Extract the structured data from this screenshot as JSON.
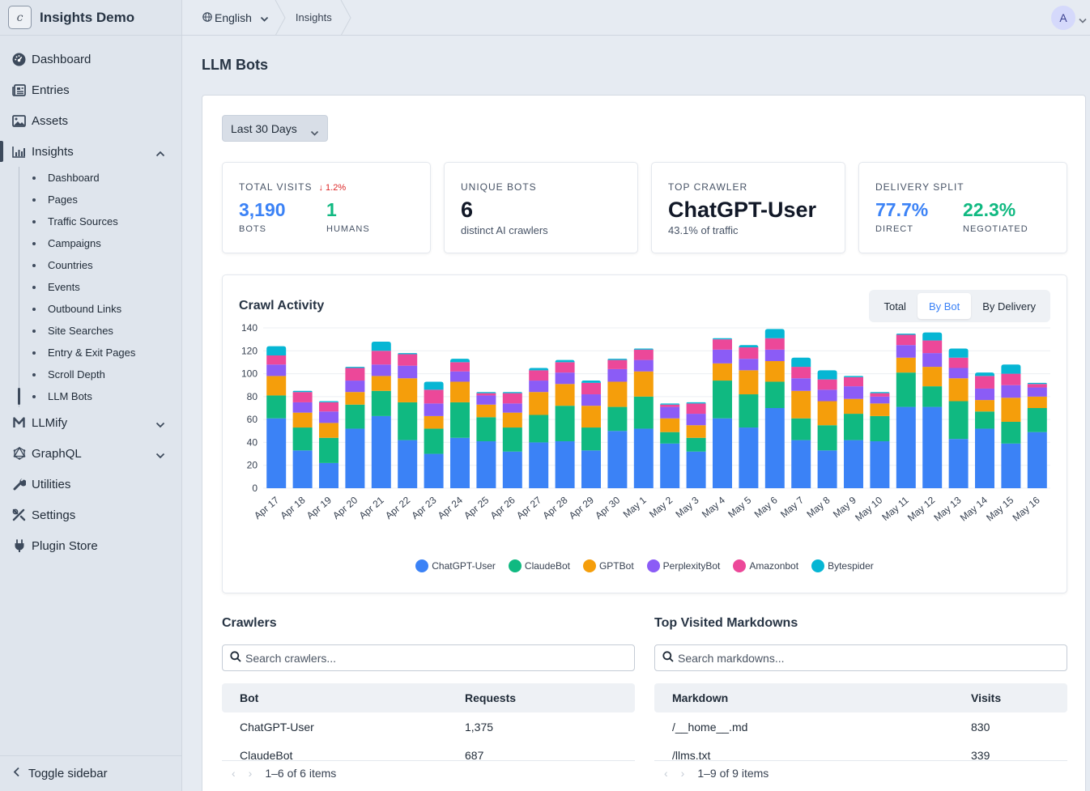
{
  "app": {
    "name": "Insights Demo",
    "logo_letter": "c"
  },
  "sidebar": {
    "items": [
      {
        "label": "Dashboard",
        "icon": "gauge-icon"
      },
      {
        "label": "Entries",
        "icon": "newspaper-icon"
      },
      {
        "label": "Assets",
        "icon": "image-icon"
      },
      {
        "label": "Insights",
        "icon": "bar-chart-icon"
      }
    ],
    "insights_sub": [
      "Dashboard",
      "Pages",
      "Traffic Sources",
      "Campaigns",
      "Countries",
      "Events",
      "Outbound Links",
      "Site Searches",
      "Entry & Exit Pages",
      "Scroll Depth",
      "LLM Bots"
    ],
    "after": [
      {
        "label": "LLMify",
        "icon": "m-logo-icon"
      },
      {
        "label": "GraphQL",
        "icon": "graphql-icon"
      },
      {
        "label": "Utilities",
        "icon": "wrench-icon"
      },
      {
        "label": "Settings",
        "icon": "settings-icon"
      },
      {
        "label": "Plugin Store",
        "icon": "plug-icon"
      }
    ],
    "toggle_label": "Toggle sidebar"
  },
  "topbar": {
    "language": "English",
    "breadcrumb": "Insights",
    "avatar_initial": "A"
  },
  "page": {
    "title": "LLM Bots",
    "range_select": "Last 30 Days"
  },
  "stats": {
    "total_visits": {
      "label": "Total Visits",
      "trend": "↓ 1.2%",
      "bots_value": "3,190",
      "bots_label": "Bots",
      "humans_value": "1",
      "humans_label": "Humans"
    },
    "unique_bots": {
      "label": "Unique Bots",
      "value": "6",
      "caption": "distinct AI crawlers"
    },
    "top_crawler": {
      "label": "Top Crawler",
      "value": "ChatGPT-User",
      "caption": "43.1% of traffic"
    },
    "delivery_split": {
      "label": "Delivery Split",
      "direct_value": "77.7%",
      "direct_label": "Direct",
      "negotiated_value": "22.3%",
      "negotiated_label": "Negotiated"
    }
  },
  "chart": {
    "title": "Crawl Activity",
    "toggles": [
      "Total",
      "By Bot",
      "By Delivery"
    ],
    "active_toggle": "By Bot"
  },
  "chart_data": {
    "type": "bar",
    "stacked": true,
    "categories": [
      "Apr 17",
      "Apr 18",
      "Apr 19",
      "Apr 20",
      "Apr 21",
      "Apr 22",
      "Apr 23",
      "Apr 24",
      "Apr 25",
      "Apr 26",
      "Apr 27",
      "Apr 28",
      "Apr 29",
      "Apr 30",
      "May 1",
      "May 2",
      "May 3",
      "May 4",
      "May 5",
      "May 6",
      "May 7",
      "May 8",
      "May 9",
      "May 10",
      "May 11",
      "May 12",
      "May 13",
      "May 14",
      "May 15",
      "May 16"
    ],
    "ylim": [
      0,
      140
    ],
    "yticks": [
      0,
      20,
      40,
      60,
      80,
      100,
      120,
      140
    ],
    "grid": true,
    "legend_position": "bottom",
    "series": [
      {
        "name": "ChatGPT-User",
        "color": "#3b82f6",
        "values": [
          61,
          33,
          22,
          52,
          63,
          42,
          30,
          44,
          41,
          32,
          40,
          41,
          33,
          50,
          52,
          39,
          32,
          61,
          53,
          70,
          42,
          33,
          42,
          41,
          71,
          71,
          43,
          52,
          39,
          49
        ]
      },
      {
        "name": "ClaudeBot",
        "color": "#10b981",
        "values": [
          20,
          20,
          22,
          21,
          22,
          33,
          22,
          31,
          21,
          21,
          24,
          31,
          20,
          21,
          28,
          10,
          12,
          33,
          29,
          23,
          19,
          22,
          23,
          22,
          30,
          18,
          33,
          15,
          19,
          21
        ]
      },
      {
        "name": "GPTBot",
        "color": "#f59e0b",
        "values": [
          17,
          13,
          13,
          11,
          13,
          21,
          11,
          18,
          11,
          13,
          20,
          19,
          19,
          22,
          22,
          12,
          11,
          15,
          21,
          18,
          24,
          21,
          13,
          11,
          13,
          17,
          20,
          10,
          21,
          10
        ]
      },
      {
        "name": "PerplexityBot",
        "color": "#8b5cf6",
        "values": [
          10,
          9,
          10,
          10,
          10,
          11,
          11,
          9,
          8,
          8,
          10,
          10,
          10,
          11,
          10,
          10,
          10,
          12,
          10,
          10,
          11,
          10,
          11,
          6,
          11,
          12,
          9,
          10,
          11,
          8
        ]
      },
      {
        "name": "Amazonbot",
        "color": "#ec4899",
        "values": [
          8,
          9,
          8,
          11,
          12,
          10,
          12,
          8,
          2,
          9,
          9,
          9,
          10,
          8,
          9,
          2,
          9,
          9,
          10,
          10,
          10,
          9,
          8,
          3,
          9,
          11,
          9,
          11,
          10,
          3
        ]
      },
      {
        "name": "Bytespider",
        "color": "#06b6d4",
        "values": [
          8,
          1,
          1,
          1,
          8,
          1,
          7,
          3,
          1,
          1,
          2,
          2,
          2,
          1,
          1,
          1,
          1,
          1,
          2,
          8,
          8,
          8,
          1,
          1,
          1,
          7,
          8,
          3,
          8,
          1
        ]
      }
    ]
  },
  "crawlers": {
    "title": "Crawlers",
    "search_placeholder": "Search crawlers...",
    "columns": [
      "Bot",
      "Requests"
    ],
    "rows": [
      [
        "ChatGPT-User",
        "1,375"
      ],
      [
        "ClaudeBot",
        "687"
      ]
    ],
    "pager": "1–6 of 6 items"
  },
  "markdowns": {
    "title": "Top Visited Markdowns",
    "search_placeholder": "Search markdowns...",
    "columns": [
      "Markdown",
      "Visits"
    ],
    "rows": [
      [
        "/__home__.md",
        "830"
      ],
      [
        "/llms.txt",
        "339"
      ]
    ],
    "pager": "1–9 of 9 items"
  }
}
